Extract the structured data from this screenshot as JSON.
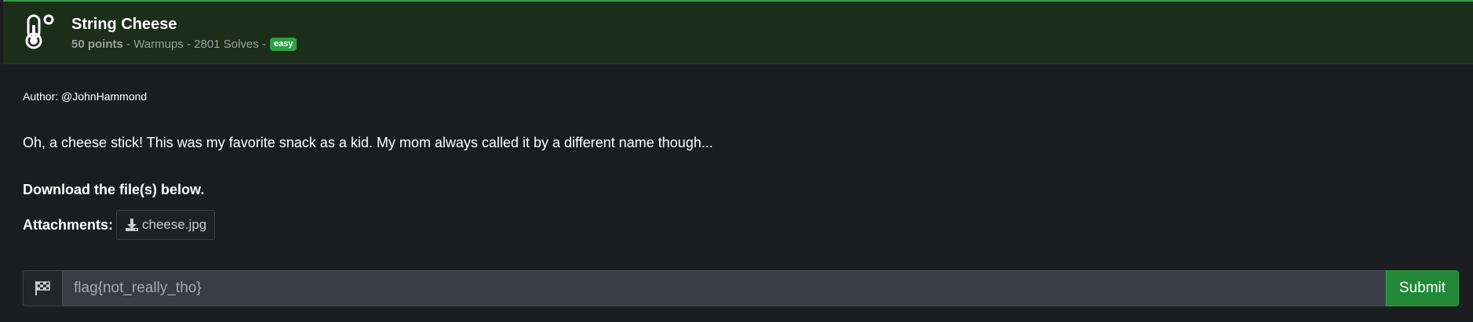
{
  "challenge": {
    "icon": "thermometer-icon",
    "title": "String Cheese",
    "points": "50 points",
    "category": " - Warmups - ",
    "solves": "2801 Solves",
    "separator": " -",
    "difficulty": "easy"
  },
  "content": {
    "author": "Author: @JohnHammond",
    "description": "Oh, a cheese stick! This was my favorite snack as a kid. My mom always called it by a different name though...",
    "download_note": "Download the file(s) below.",
    "attachments_label": "Attachments:",
    "attachment": {
      "icon": "download-icon",
      "name": "cheese.jpg"
    }
  },
  "flag_form": {
    "icon": "checkered-flag-icon",
    "placeholder": "flag{not_really_tho}",
    "value": "",
    "submit_label": "Submit"
  },
  "colors": {
    "header_bg": "#1a2e1a",
    "accent_green": "#2ea043",
    "page_bg": "#1b1c1f",
    "input_bg": "#393c44"
  }
}
